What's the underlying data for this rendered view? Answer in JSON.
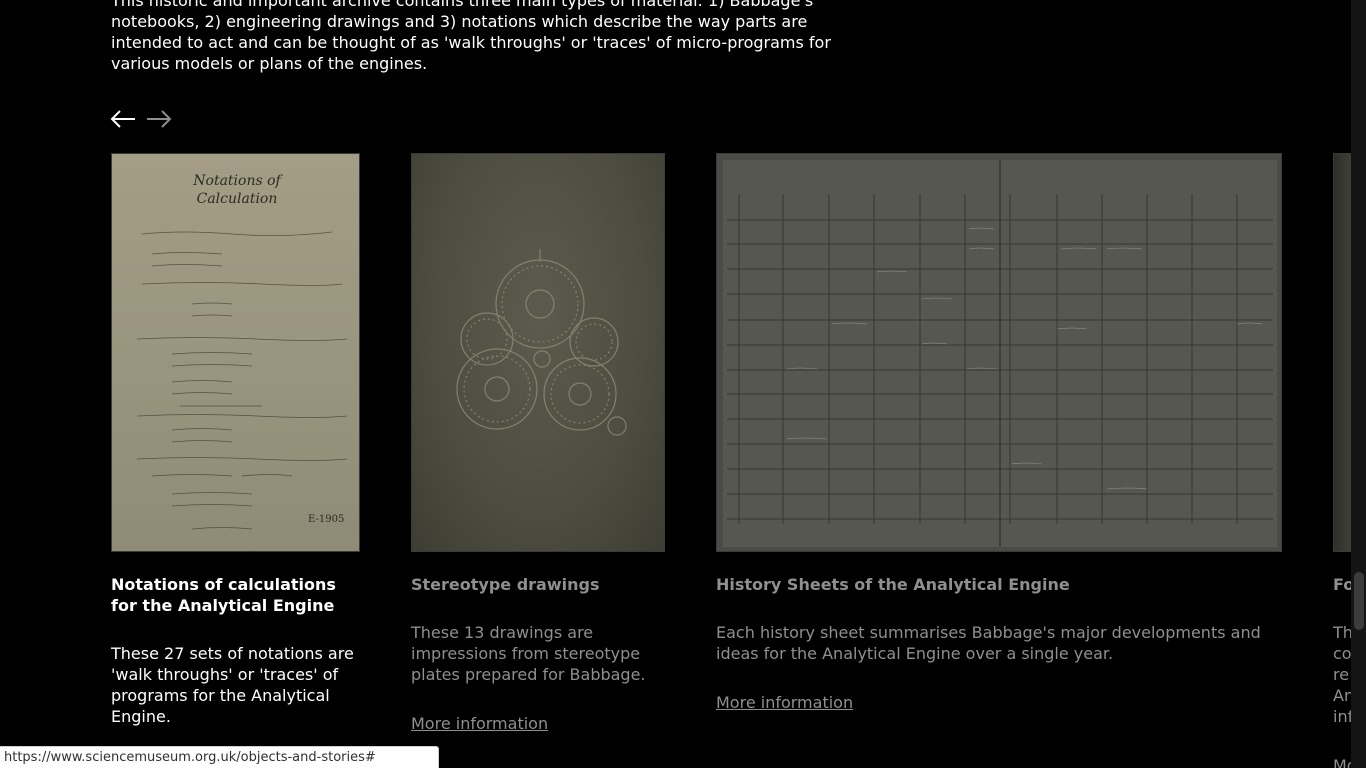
{
  "intro_text": "This historic and important archive contains three main types of material: 1) Babbage's notebooks, 2) engineering drawings and 3) notations which describe the way parts are intended to act and can be thought of as 'walk throughs' or 'traces' of micro-programs for various models or plans of the engines.",
  "carousel": {
    "prev_icon": "arrow-left-icon",
    "next_icon": "arrow-right-icon",
    "cards": [
      {
        "title": "Notations of calculations for the Analytical Engine",
        "description": "These 27 sets of notations are 'walk throughs' or 'traces' of programs for the Analytical Engine.",
        "image": {
          "heading": "Notations of Calculation",
          "corner": "E-1905"
        }
      },
      {
        "title": "Stereotype drawings",
        "description": "These 13 drawings are impressions from stereotype plates prepared for Babbage.",
        "link": "More information"
      },
      {
        "title": "History Sheets of the Analytical Engine",
        "description": "Each history sheet summarises Babbage's major developments and ideas for the Analytical Engine over a single year.",
        "link": "More information"
      },
      {
        "title": "Fo",
        "description": "Th co re An inf",
        "link": "Mo"
      }
    ]
  },
  "status_bar": {
    "url": "https://www.sciencemuseum.org.uk/objects-and-stories#"
  },
  "colors": {
    "background": "#000000",
    "text": "#ffffff",
    "muted_text": "#8f8f8f"
  }
}
